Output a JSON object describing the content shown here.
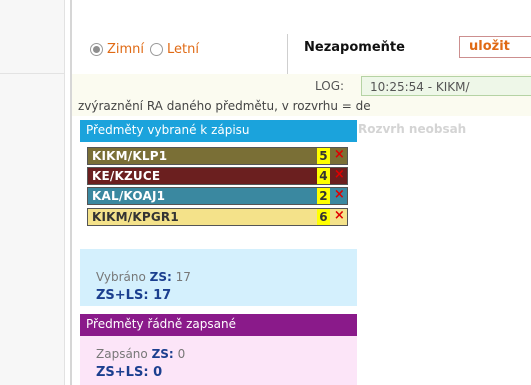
{
  "semester": {
    "options": [
      "Zimní",
      "Letní"
    ],
    "selected": "Zimní"
  },
  "reminder": {
    "text": "Nezapomeňte",
    "save_label": "uložit"
  },
  "log": {
    "label": "LOG:",
    "value": "10:25:54 - KIKM/"
  },
  "hint_text": "zvýraznění RA daného předmětu, v rozvrhu = de",
  "schedule_note": "Rozvrh neobsah",
  "selected_panel": {
    "title": "Předměty vybrané k zápisu",
    "courses": [
      {
        "code": "KIKM/KLP1",
        "credits": "5",
        "bg": "#7a6f36",
        "fg": "#ffffff"
      },
      {
        "code": "KE/KZUCE",
        "credits": "4",
        "bg": "#6b1f1f",
        "fg": "#ffffff"
      },
      {
        "code": "KAL/KOAJ1",
        "credits": "2",
        "bg": "#3a88a0",
        "fg": "#ffffff"
      },
      {
        "code": "KIKM/KPGR1",
        "credits": "6",
        "bg": "#f4e28a",
        "fg": "#333333"
      }
    ],
    "remove_icon": "×",
    "summary_label": "Vybráno",
    "zs_label": "ZS:",
    "zs_value": "17",
    "zsls_label": "ZS+LS:",
    "zsls_value": "17"
  },
  "enrolled_panel": {
    "title": "Předměty řádně zapsané",
    "summary_label": "Zapsáno",
    "zs_label": "ZS:",
    "zs_value": "0",
    "zsls_label": "ZS+LS:",
    "zsls_value": "0"
  },
  "colors": {
    "selected_header": "#1ba3dc",
    "enrolled_header": "#8a1a8a",
    "accent_orange": "#e06a14",
    "remove_red": "#e00000"
  }
}
